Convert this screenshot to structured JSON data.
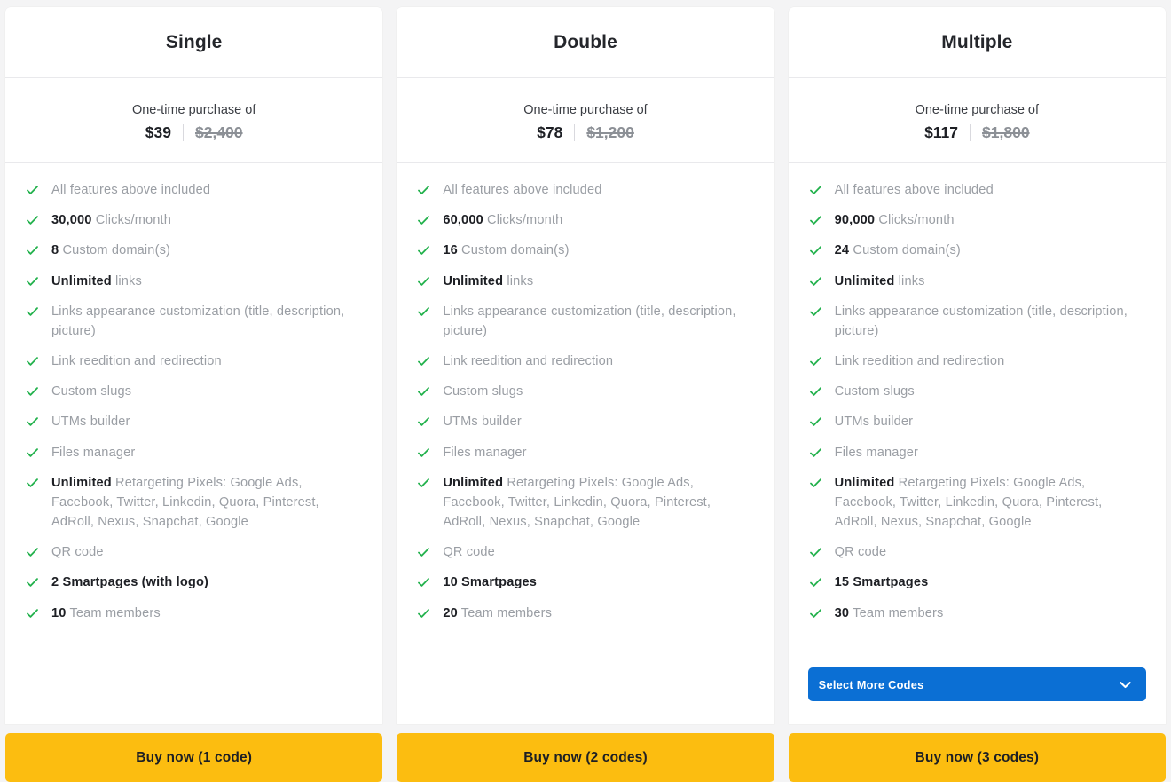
{
  "page": {
    "background_color": "#f4f4f5",
    "card_color": "#ffffff",
    "check_color": "#22b14c",
    "buy_button_color": "#fcbd10",
    "select_button_color": "#0b6fd4"
  },
  "price_caption": "One-time purchase of",
  "plans": [
    {
      "title": "Single",
      "price": "$39",
      "old_price": "$2,400",
      "buy_label": "Buy now (1 code)",
      "features": [
        {
          "bold": "",
          "text": "All features above included"
        },
        {
          "bold": "30,000",
          "text": " Clicks/month"
        },
        {
          "bold": "8",
          "text": " Custom domain(s)"
        },
        {
          "bold": "Unlimited",
          "text": " links"
        },
        {
          "bold": "",
          "text": "Links appearance customization (title, description, picture)"
        },
        {
          "bold": "",
          "text": "Link reedition and redirection"
        },
        {
          "bold": "",
          "text": "Custom slugs"
        },
        {
          "bold": "",
          "text": "UTMs builder"
        },
        {
          "bold": "",
          "text": "Files manager"
        },
        {
          "bold": "Unlimited",
          "text": " Retargeting Pixels: Google Ads, Facebook, Twitter, Linkedin, Quora, Pinterest, AdRoll, Nexus, Snapchat, Google"
        },
        {
          "bold": "",
          "text": "QR code"
        },
        {
          "bold": "2 Smartpages (with logo)",
          "text": "",
          "all_bold": true
        },
        {
          "bold": "10",
          "text": " Team members"
        }
      ],
      "select_more": null
    },
    {
      "title": "Double",
      "price": "$78",
      "old_price": "$1,200",
      "buy_label": "Buy now (2 codes)",
      "features": [
        {
          "bold": "",
          "text": "All features above included"
        },
        {
          "bold": "60,000",
          "text": " Clicks/month"
        },
        {
          "bold": "16",
          "text": " Custom domain(s)"
        },
        {
          "bold": "Unlimited",
          "text": " links"
        },
        {
          "bold": "",
          "text": "Links appearance customization (title, description, picture)"
        },
        {
          "bold": "",
          "text": "Link reedition and redirection"
        },
        {
          "bold": "",
          "text": "Custom slugs"
        },
        {
          "bold": "",
          "text": "UTMs builder"
        },
        {
          "bold": "",
          "text": "Files manager"
        },
        {
          "bold": "Unlimited",
          "text": " Retargeting Pixels: Google Ads, Facebook, Twitter, Linkedin, Quora, Pinterest, AdRoll, Nexus, Snapchat, Google"
        },
        {
          "bold": "",
          "text": "QR code"
        },
        {
          "bold": "10 Smartpages",
          "text": "",
          "all_bold": true
        },
        {
          "bold": "20",
          "text": " Team members"
        }
      ],
      "select_more": null
    },
    {
      "title": "Multiple",
      "price": "$117",
      "old_price": "$1,800",
      "buy_label": "Buy now (3 codes)",
      "features": [
        {
          "bold": "",
          "text": "All features above included"
        },
        {
          "bold": "90,000",
          "text": " Clicks/month"
        },
        {
          "bold": "24",
          "text": " Custom domain(s)"
        },
        {
          "bold": "Unlimited",
          "text": " links"
        },
        {
          "bold": "",
          "text": "Links appearance customization (title, description, picture)"
        },
        {
          "bold": "",
          "text": "Link reedition and redirection"
        },
        {
          "bold": "",
          "text": "Custom slugs"
        },
        {
          "bold": "",
          "text": "UTMs builder"
        },
        {
          "bold": "",
          "text": "Files manager"
        },
        {
          "bold": "Unlimited",
          "text": " Retargeting Pixels: Google Ads, Facebook, Twitter, Linkedin, Quora, Pinterest, AdRoll, Nexus, Snapchat, Google"
        },
        {
          "bold": "",
          "text": "QR code"
        },
        {
          "bold": "15 Smartpages",
          "text": "",
          "all_bold": true
        },
        {
          "bold": "30",
          "text": " Team members"
        }
      ],
      "select_more": "Select More Codes"
    }
  ]
}
